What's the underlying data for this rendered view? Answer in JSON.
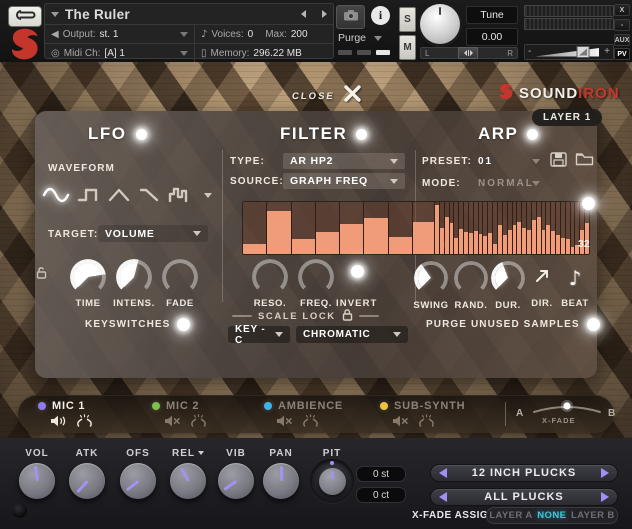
{
  "header": {
    "title": "The Ruler",
    "output_label": "Output:",
    "output_value": "st. 1",
    "voices_label": "Voices:",
    "voices_value": "0",
    "max_label": "Max:",
    "max_value": "200",
    "midi_label": "Midi Ch:",
    "midi_value": "[A] 1",
    "memory_label": "Memory:",
    "memory_value": "296.22 MB",
    "purge_label": "Purge",
    "solo_label": "S",
    "mute_label": "M",
    "tune_label": "Tune",
    "tune_value": "0.00",
    "pan_left": "L",
    "pan_right": "R",
    "volume_minus": "-",
    "volume_plus": "+",
    "win_close": "X",
    "win_minimize": "-",
    "aux_label": "AUX",
    "pv_label": "PV"
  },
  "overlay": {
    "close_label": "CLOSE",
    "brand_sound": "SOUND",
    "brand_iron": "IRON",
    "layer_badge": "LAYER 1"
  },
  "lfo": {
    "title": "LFO",
    "enabled": true,
    "waveform_label": "WAVEFORM",
    "selected_waveform": "sine",
    "target_label": "TARGET:",
    "target_value": "VOLUME",
    "knobs": [
      {
        "label": "TIME",
        "arc": 216
      },
      {
        "label": "INTENS.",
        "arc": 150
      },
      {
        "label": "FADE",
        "arc": 0
      }
    ],
    "keyswitches_label": "KEYSWITCHES",
    "keyswitches_on": true
  },
  "filter": {
    "title": "FILTER",
    "enabled": true,
    "type_label": "TYPE:",
    "type_value": "AR HP2",
    "source_label": "SOURCE:",
    "source_value": "GRAPH FREQ",
    "graph_steps_label": "8",
    "graph_values": [
      0.2,
      0.82,
      0.28,
      0.42,
      0.58,
      0.7,
      0.33,
      0.62
    ],
    "knobs": [
      {
        "label": "RESO.",
        "arc": 0
      },
      {
        "label": "FREQ.",
        "arc": 0
      }
    ],
    "invert_label": "INVERT",
    "invert_on": true,
    "scale_lock_label": "SCALE LOCK",
    "key_value": "KEY - C",
    "scale_value": "CHROMATIC"
  },
  "arp": {
    "title": "ARP",
    "enabled": true,
    "preset_label": "PRESET:",
    "preset_value": "01",
    "mode_label": "MODE:",
    "mode_value": "NORMAL",
    "graph_steps_label": "32",
    "graph_values": [
      0.95,
      0.5,
      0.72,
      0.6,
      0.3,
      0.48,
      0.42,
      0.4,
      0.44,
      0.38,
      0.34,
      0.4,
      0.2,
      0.56,
      0.36,
      0.46,
      0.56,
      0.62,
      0.5,
      0.46,
      0.66,
      0.72,
      0.46,
      0.56,
      0.44,
      0.36,
      0.3,
      0.28,
      0.14,
      0.18,
      0.46,
      0.6
    ],
    "graph_enabled": true,
    "knobs": [
      {
        "label": "SWING",
        "arc": 100
      },
      {
        "label": "RAND.",
        "arc": 0
      },
      {
        "label": "DUR.",
        "arc": 115
      }
    ],
    "dir_label": "DIR.",
    "beat_label": "BEAT",
    "purge_label": "PURGE UNUSED SAMPLES",
    "purge_on": true
  },
  "mixer": {
    "mics": [
      {
        "label": "MIC 1",
        "color": "#8d7bf0",
        "active": true,
        "muted": false
      },
      {
        "label": "MIC 2",
        "color": "#7bc24a",
        "active": false,
        "muted": true
      },
      {
        "label": "AMBIENCE",
        "color": "#3cb4e8",
        "active": false,
        "muted": true
      },
      {
        "label": "SUB-SYNTH",
        "color": "#eec23e",
        "active": false,
        "muted": true
      }
    ],
    "xfade": {
      "a": "A",
      "b": "B",
      "label": "X-FADE",
      "position": 0.5
    }
  },
  "bottom": {
    "knobs": [
      {
        "label": "VOL",
        "angle": -8
      },
      {
        "label": "ATK",
        "angle": -138
      },
      {
        "label": "OFS",
        "angle": -128
      },
      {
        "label": "REL",
        "angle": -30
      },
      {
        "label": "VIB",
        "angle": -125
      },
      {
        "label": "PAN",
        "angle": 0
      },
      {
        "label": "PIT",
        "angle": 0
      }
    ],
    "pitch_semitones": "0 st",
    "pitch_cents": "0 ct",
    "selector_top": "12 INCH PLUCKS",
    "selector_bottom": "ALL PLUCKS",
    "xfade_assign_label": "X-FADE ASSIGN",
    "xfade_assign_options": [
      {
        "label": "LAYER A",
        "active": false
      },
      {
        "label": "NONE",
        "active": true
      },
      {
        "label": "LAYER B",
        "active": false
      }
    ]
  },
  "colors": {
    "accent_bar": "#f09c79",
    "knob_pointer": "#a492f2",
    "active_option": "#41c4da",
    "brand_red": "#c6382d"
  }
}
